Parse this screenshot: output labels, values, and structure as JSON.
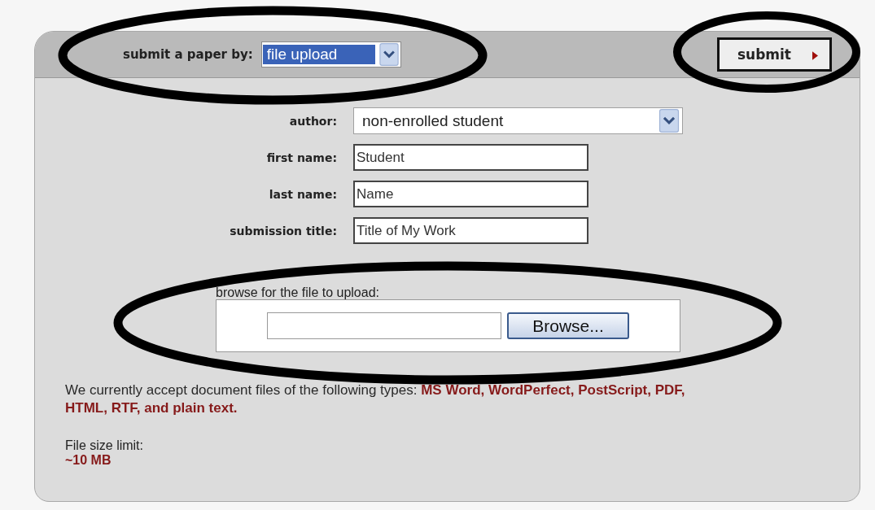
{
  "header": {
    "label": "submit a paper by:",
    "method": {
      "value": "file upload",
      "highlighted": true
    },
    "submit": "submit"
  },
  "fields": [
    {
      "label": "author:",
      "kind": "select",
      "value": "non-enrolled student"
    },
    {
      "label": "first name:",
      "kind": "text",
      "value": "Student"
    },
    {
      "label": "last name:",
      "kind": "text",
      "value": "Name"
    },
    {
      "label": "submission title:",
      "kind": "text",
      "value": "Title of My Work"
    }
  ],
  "upload": {
    "label": "browse for the file to upload:",
    "button": "Browse..."
  },
  "note": "We currently accept document files of the following types: **MS Word, WordPerfect, PostScript, PDF, HTML, RTF, and plain text.**",
  "size_limit": {
    "label": "File size limit:",
    "value": "~10 MB"
  }
}
